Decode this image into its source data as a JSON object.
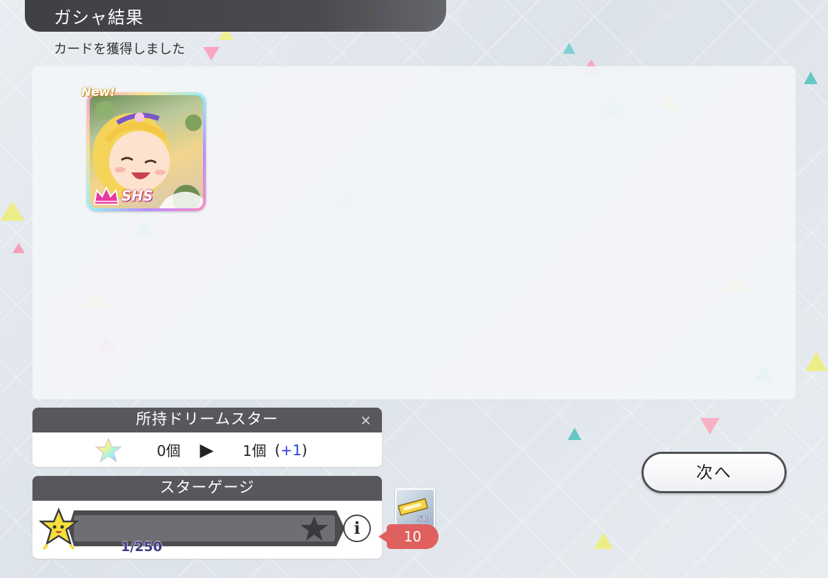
{
  "header": {
    "title": "ガシャ結果"
  },
  "subtitle": "カードを獲得しました",
  "card": {
    "new_label": "New!",
    "rarity": "SHS"
  },
  "dream_stars": {
    "title": "所持ドリームスター",
    "close_label": "×",
    "before": "0個",
    "arrow": "▶",
    "after": "1個",
    "delta_open": "(",
    "delta": "+1",
    "delta_close": ")"
  },
  "star_gauge": {
    "title": "スターゲージ",
    "count": "1/250",
    "progress": 0.004,
    "info_label": "i",
    "reward_badge": "SR",
    "reward_count": "10"
  },
  "next_button": {
    "label": "次へ"
  },
  "colors": {
    "accent": "#57575c",
    "delta_color": "#2b3fe0",
    "reward_tag": "#e06060"
  }
}
